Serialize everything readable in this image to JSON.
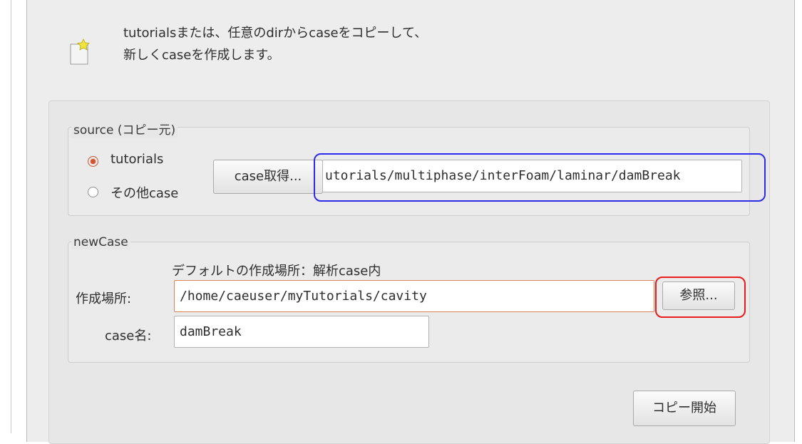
{
  "header": {
    "line1": "tutorialsまたは、任意のdirからcaseをコピーして、",
    "line2": "新しくcaseを作成します。",
    "icon": "new-document-icon"
  },
  "source": {
    "title": "source (コピー元)",
    "options": [
      "tutorials",
      "その他case"
    ],
    "selected": "tutorials",
    "get_case_button": "case取得...",
    "path_value": "utorials/multiphase/interFoam/laminar/damBreak"
  },
  "newcase": {
    "title": "newCase",
    "default_note": "デフォルトの作成場所：解析case内",
    "location_label": "作成場所:",
    "location_value": "/home/caeuser/myTutorials/cavity",
    "browse_button": "参照...",
    "name_label": "case名:",
    "name_value": "damBreak"
  },
  "actions": {
    "start_copy_button": "コピー開始"
  },
  "colors": {
    "highlight_blue": "#2d2be8",
    "highlight_red": "#ea1b1b",
    "radio_accent": "#d7532f"
  }
}
